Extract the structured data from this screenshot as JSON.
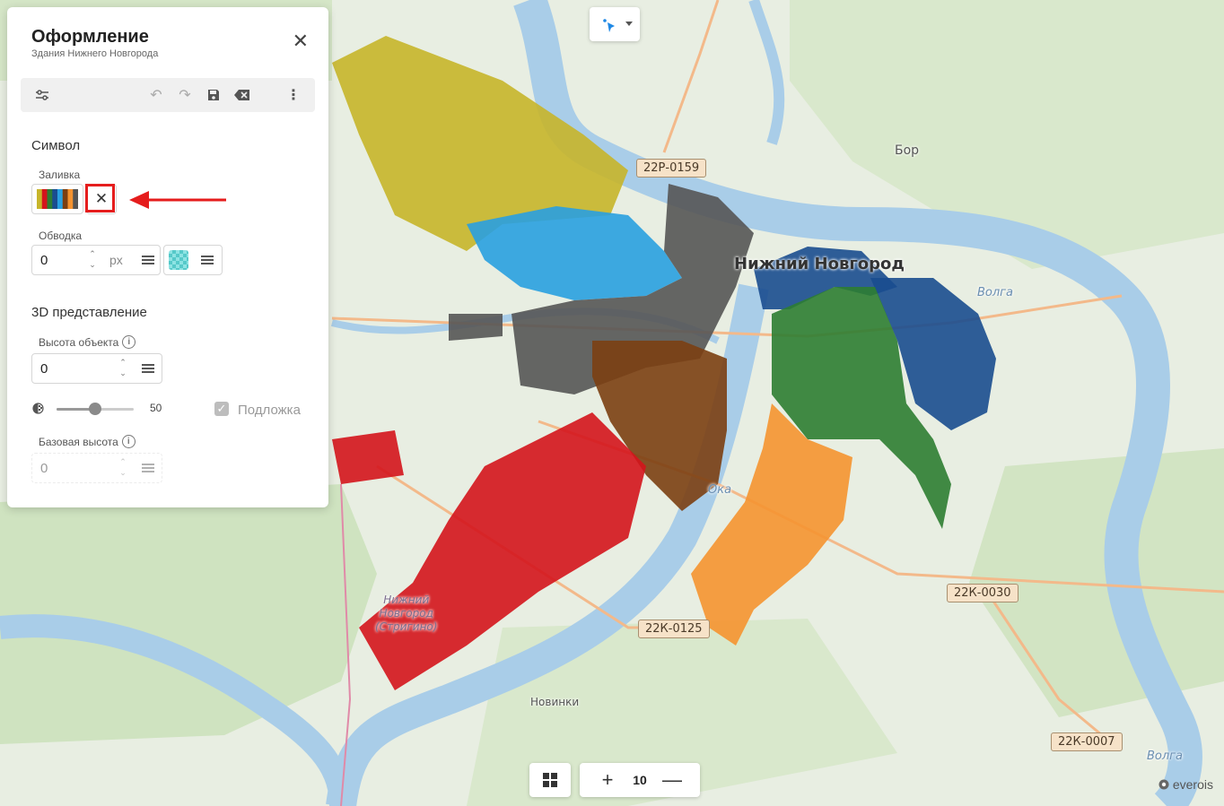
{
  "panel": {
    "title": "Оформление",
    "subtitle": "Здания Нижнего Новгорода"
  },
  "symbol": {
    "section_title": "Символ",
    "fill_label": "Заливка",
    "stroke_label": "Обводка",
    "stroke_width": "0",
    "stroke_unit": "px",
    "stroke_color": "#6fd6d6"
  },
  "threeD": {
    "section_title": "3D представление",
    "height_label": "Высота объекта",
    "height_value": "0",
    "opacity_value": "50",
    "opacity_fraction": 0.5,
    "backing_label": "Подложка",
    "backing_checked": true,
    "base_height_label": "Базовая высота",
    "base_height_value": "0"
  },
  "palette": [
    "#c7b52a",
    "#d4141c",
    "#2e7d32",
    "#1a4d8f",
    "#29a0e0",
    "#7b3f12",
    "#f59330",
    "#555555"
  ],
  "map": {
    "labels": {
      "city": "Нижний Новгород",
      "bor": "Бор",
      "volga1": "Волга",
      "volga2": "Волга",
      "oka": "Ока",
      "novinki": "Новинки",
      "airport": [
        "Нижний",
        "Новгород",
        "(Стригино)"
      ]
    },
    "roads": [
      "22Р-0159",
      "22К-0030",
      "22К-0125",
      "22К-0007"
    ]
  },
  "zoom": {
    "level": "10"
  },
  "brand": "everois",
  "colors": {
    "accent": "#1e88e5",
    "highlight": "#e51d1d"
  }
}
